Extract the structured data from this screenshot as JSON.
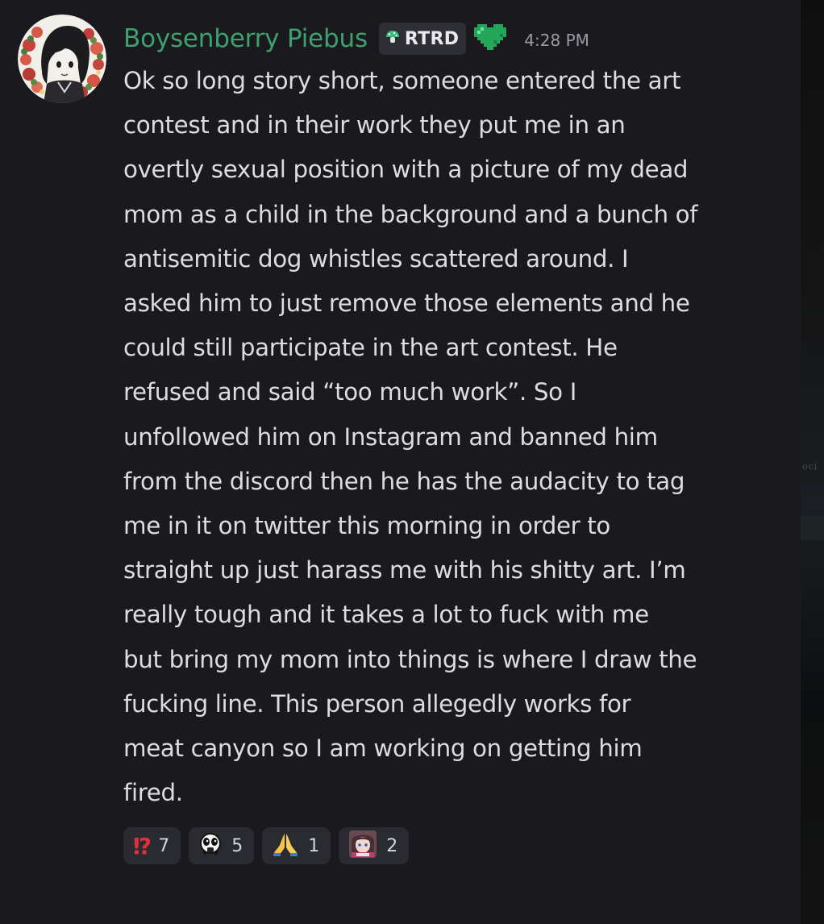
{
  "message": {
    "username": "Boysenberry Piebus",
    "username_color": "#3ea06f",
    "tag_label": "RTRD",
    "tag_icon": "mushroom-icon",
    "badge_icon": "green-heart-icon",
    "timestamp": "4:28 PM",
    "text": "Ok so long story short, someone entered the art\ncontest and in their work they put me in an\novertly sexual position with a picture of my dead\nmom as a child in the background and a bunch of\nantisemitic dog whistles scattered around. I\nasked him to just remove those elements and he\ncould still participate in the art contest. He\nrefused and said “too much work”. So I\nunfollowed him on Instagram and banned him\nfrom the discord then he has the audacity to tag\nme in it on twitter this morning in order to\nstraight up just harass me with his shitty art. I’m\nreally tough and it takes a lot to fuck with me\nbut bring my mom into things is where I draw the\nfucking line. This person allegedly works for\nmeat canyon so I am working on getting him\nfired."
  },
  "reactions": [
    {
      "emoji": "⁉",
      "icon": "interrobang-icon",
      "count": "7"
    },
    {
      "emoji": "",
      "icon": "custom-face-emoji-icon",
      "count": "5"
    },
    {
      "emoji": "",
      "icon": "folded-hands-icon",
      "count": "1"
    },
    {
      "emoji": "",
      "icon": "custom-anime-emoji-icon",
      "count": "2"
    }
  ],
  "right_edge_fragment": "oci"
}
